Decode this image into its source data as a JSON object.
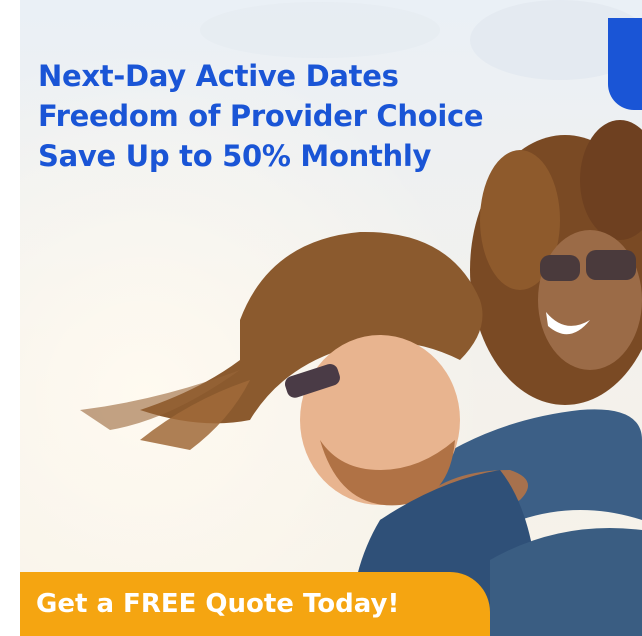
{
  "ad": {
    "headline": [
      "Next-Day Active Dates",
      "Freedom of Provider Choice",
      "Save Up to 50% Monthly"
    ],
    "cta_label": "Get a FREE Quote Today!"
  },
  "colors": {
    "brand_blue": "#1a55d6",
    "cta_orange": "#f5a511",
    "text_white": "#ffffff"
  }
}
